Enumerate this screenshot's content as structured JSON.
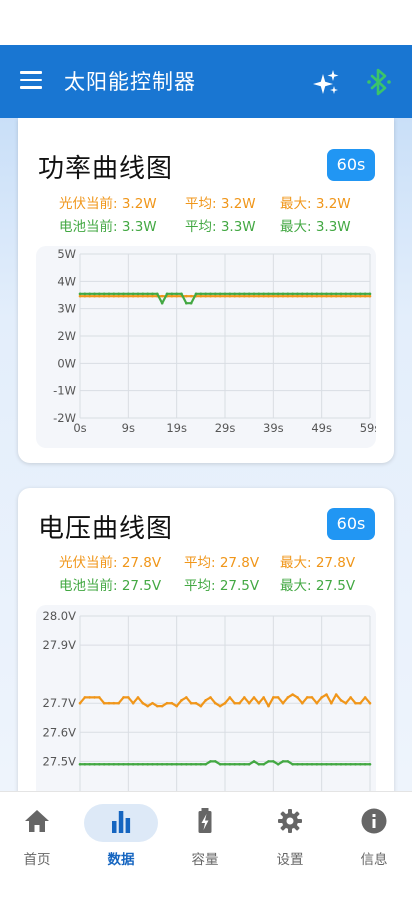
{
  "app": {
    "title": "太阳能控制器"
  },
  "power_card": {
    "title": "功率曲线图",
    "range": "60s",
    "stats": {
      "pv_now": "光伏当前: 3.2W",
      "pv_avg": "平均: 3.2W",
      "pv_max": "最大: 3.2W",
      "bat_now": "电池当前: 3.3W",
      "bat_avg": "平均: 3.3W",
      "bat_max": "最大: 3.3W"
    }
  },
  "voltage_card": {
    "title": "电压曲线图",
    "range": "60s",
    "stats": {
      "pv_now": "光伏当前: 27.8V",
      "pv_avg": "平均: 27.8V",
      "pv_max": "最大: 27.8V",
      "bat_now": "电池当前: 27.5V",
      "bat_avg": "平均: 27.5V",
      "bat_max": "最大: 27.5V"
    }
  },
  "colors": {
    "pv": "#f0961a",
    "battery": "#43a843",
    "primary": "#1976d2",
    "accent": "#2196f3"
  },
  "chart_data": [
    {
      "type": "line",
      "x_tick_labels": [
        "0s",
        "9s",
        "19s",
        "29s",
        "39s",
        "49s",
        "59s"
      ],
      "y_tick_labels": [
        "5W",
        "4W",
        "3W",
        "2W",
        "0W",
        "-1W",
        "-2W"
      ],
      "ylim": [
        -2,
        5
      ],
      "xlim": [
        0,
        60
      ],
      "grid": true,
      "series": [
        {
          "color": "#f0961a",
          "values": [
            3.2,
            3.2,
            3.2,
            3.2,
            3.2,
            3.2,
            3.2,
            3.2,
            3.2,
            3.2,
            3.2,
            3.2,
            3.2,
            3.2,
            3.2,
            3.2,
            3.2,
            3.2,
            3.2,
            3.2,
            3.2,
            3.2,
            3.2,
            3.2,
            3.2,
            3.2,
            3.2,
            3.2,
            3.2,
            3.2,
            3.2,
            3.2,
            3.2,
            3.2,
            3.2,
            3.2,
            3.2,
            3.2,
            3.2,
            3.2,
            3.2,
            3.2,
            3.2,
            3.2,
            3.2,
            3.2,
            3.2,
            3.2,
            3.2,
            3.2,
            3.2,
            3.2,
            3.2,
            3.2,
            3.2,
            3.2,
            3.2,
            3.2,
            3.2,
            3.2,
            3.2
          ]
        },
        {
          "color": "#43a843",
          "values": [
            3.3,
            3.3,
            3.3,
            3.3,
            3.3,
            3.3,
            3.3,
            3.3,
            3.3,
            3.3,
            3.3,
            3.3,
            3.3,
            3.3,
            3.3,
            3.3,
            3.3,
            2.9,
            3.3,
            3.3,
            3.3,
            3.3,
            2.9,
            2.9,
            3.3,
            3.3,
            3.3,
            3.3,
            3.3,
            3.3,
            3.3,
            3.3,
            3.3,
            3.3,
            3.3,
            3.3,
            3.3,
            3.3,
            3.3,
            3.3,
            3.3,
            3.3,
            3.3,
            3.3,
            3.3,
            3.3,
            3.3,
            3.3,
            3.3,
            3.3,
            3.3,
            3.3,
            3.3,
            3.3,
            3.3,
            3.3,
            3.3,
            3.3,
            3.3,
            3.3,
            3.3
          ]
        }
      ]
    },
    {
      "type": "line",
      "y_tick_labels": [
        "28.0V",
        "27.9V",
        "27.7V",
        "27.6V",
        "27.5V"
      ],
      "ylim": [
        27.46,
        28.0
      ],
      "xlim": [
        0,
        60
      ],
      "grid": true,
      "series": [
        {
          "color": "#f0961a",
          "values": [
            27.7,
            27.72,
            27.72,
            27.72,
            27.72,
            27.7,
            27.7,
            27.7,
            27.7,
            27.72,
            27.72,
            27.7,
            27.72,
            27.7,
            27.69,
            27.7,
            27.69,
            27.69,
            27.7,
            27.7,
            27.69,
            27.71,
            27.72,
            27.7,
            27.7,
            27.69,
            27.71,
            27.72,
            27.7,
            27.69,
            27.7,
            27.72,
            27.7,
            27.7,
            27.72,
            27.7,
            27.72,
            27.7,
            27.72,
            27.69,
            27.72,
            27.72,
            27.7,
            27.72,
            27.73,
            27.72,
            27.7,
            27.72,
            27.72,
            27.7,
            27.72,
            27.73,
            27.7,
            27.73,
            27.71,
            27.7,
            27.72,
            27.7,
            27.7,
            27.72,
            27.7
          ]
        },
        {
          "color": "#43a843",
          "values": [
            27.49,
            27.49,
            27.49,
            27.49,
            27.49,
            27.49,
            27.49,
            27.49,
            27.49,
            27.49,
            27.49,
            27.49,
            27.49,
            27.49,
            27.49,
            27.49,
            27.49,
            27.49,
            27.49,
            27.49,
            27.49,
            27.49,
            27.49,
            27.49,
            27.49,
            27.49,
            27.49,
            27.5,
            27.5,
            27.49,
            27.49,
            27.49,
            27.49,
            27.49,
            27.49,
            27.49,
            27.5,
            27.49,
            27.49,
            27.5,
            27.5,
            27.49,
            27.5,
            27.5,
            27.49,
            27.49,
            27.49,
            27.49,
            27.49,
            27.49,
            27.49,
            27.49,
            27.49,
            27.49,
            27.49,
            27.49,
            27.49,
            27.49,
            27.49,
            27.49,
            27.49
          ]
        }
      ]
    }
  ],
  "nav": {
    "items": [
      {
        "label": "首页",
        "icon": "home-icon"
      },
      {
        "label": "数据",
        "icon": "bar-chart-icon"
      },
      {
        "label": "容量",
        "icon": "battery-charging-icon"
      },
      {
        "label": "设置",
        "icon": "gear-icon"
      },
      {
        "label": "信息",
        "icon": "info-icon"
      }
    ],
    "active_index": 1
  }
}
